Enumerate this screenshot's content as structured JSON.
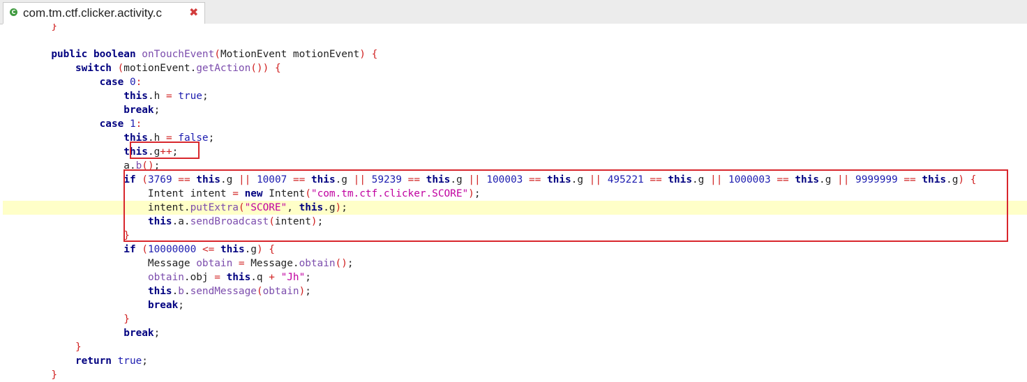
{
  "tab": {
    "title": "com.tm.ctf.clicker.activity.c",
    "icon": "class-icon",
    "close_icon": "close-icon"
  },
  "colors": {
    "keyword": "#000080",
    "method": "#7c4dad",
    "number": "#1d1db0",
    "string": "#c000a0",
    "punctuation": "#d02020",
    "highlight_line": "#ffffc8",
    "annotation_box": "#d8262c"
  },
  "code": {
    "lines": [
      "        }",
      "",
      "        public boolean onTouchEvent(MotionEvent motionEvent) {",
      "            switch (motionEvent.getAction()) {",
      "                case 0:",
      "                    this.h = true;",
      "                    break;",
      "                case 1:",
      "                    this.h = false;",
      "                    this.g++;",
      "                    a.b();",
      "                    if (3769 == this.g || 10007 == this.g || 59239 == this.g || 100003 == this.g || 495221 == this.g || 1000003 == this.g || 9999999 == this.g) {",
      "                        Intent intent = new Intent(\"com.tm.ctf.clicker.SCORE\");",
      "                        intent.putExtra(\"SCORE\", this.g);",
      "                        this.a.sendBroadcast(intent);",
      "                    }",
      "                    if (10000000 <= this.g) {",
      "                        Message obtain = Message.obtain();",
      "                        obtain.obj = this.q + \"Jh\";",
      "                        this.b.sendMessage(obtain);",
      "                        break;",
      "                    }",
      "                    break;",
      "            }",
      "            return true;",
      "        }"
    ],
    "highlighted_line_index": 13
  },
  "annotations": [
    {
      "label": "g-increment-box"
    },
    {
      "label": "score-broadcast-box"
    }
  ]
}
